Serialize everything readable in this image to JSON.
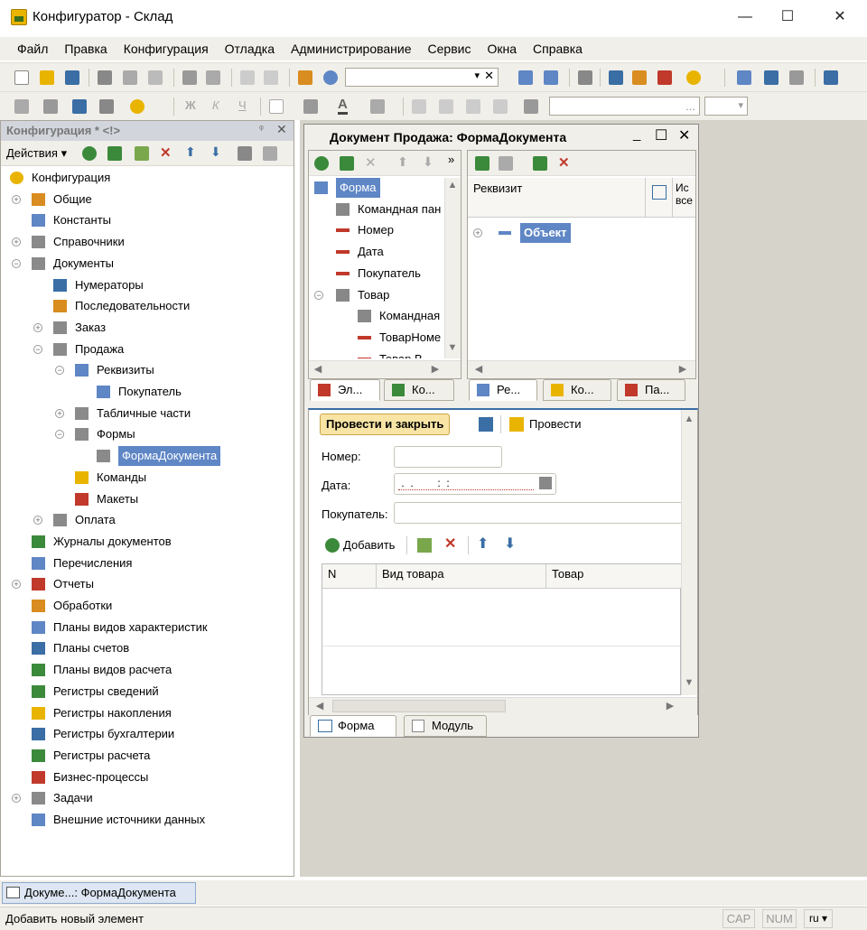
{
  "window": {
    "title": "Конфигуратор - Склад",
    "minimize": "—",
    "maximize": "☐",
    "close": "✕"
  },
  "menu": [
    "Файл",
    "Правка",
    "Конфигурация",
    "Отладка",
    "Администрирование",
    "Сервис",
    "Окна",
    "Справка"
  ],
  "left_panel": {
    "title": "Конфигурация * <!>",
    "actions_label": "Действия ▾",
    "tree": [
      {
        "label": "Конфигурация",
        "level": 0,
        "expander": "",
        "icon": "config-root-icon",
        "color": "#e9b400"
      },
      {
        "label": "Общие",
        "level": 0,
        "expander": "+",
        "icon": "common-icon",
        "color": "#d98c1f"
      },
      {
        "label": "Константы",
        "level": 0,
        "expander": "",
        "icon": "constants-icon",
        "color": "#5f86c5"
      },
      {
        "label": "Справочники",
        "level": 0,
        "expander": "+",
        "icon": "catalogs-icon",
        "color": "#8a8a8a"
      },
      {
        "label": "Документы",
        "level": 0,
        "expander": "−",
        "icon": "documents-icon",
        "color": "#8a8a8a"
      },
      {
        "label": "Нумераторы",
        "level": 1,
        "expander": "",
        "icon": "numerators-icon",
        "color": "#3a6ea5"
      },
      {
        "label": "Последовательности",
        "level": 1,
        "expander": "",
        "icon": "sequences-icon",
        "color": "#d98c1f"
      },
      {
        "label": "Заказ",
        "level": 1,
        "expander": "+",
        "icon": "document-icon",
        "color": "#8a8a8a"
      },
      {
        "label": "Продажа",
        "level": 1,
        "expander": "−",
        "icon": "document-icon",
        "color": "#8a8a8a"
      },
      {
        "label": "Реквизиты",
        "level": 2,
        "expander": "−",
        "icon": "attribute-icon",
        "color": "#5f86c5"
      },
      {
        "label": "Покупатель",
        "level": 3,
        "expander": "",
        "icon": "attribute-icon",
        "color": "#5f86c5"
      },
      {
        "label": "Табличные части",
        "level": 2,
        "expander": "+",
        "icon": "tabular-section-icon",
        "color": "#8a8a8a"
      },
      {
        "label": "Формы",
        "level": 2,
        "expander": "−",
        "icon": "forms-icon",
        "color": "#8a8a8a"
      },
      {
        "label": "ФормаДокумента",
        "level": 3,
        "expander": "",
        "icon": "form-icon",
        "color": "#8a8a8a",
        "selected": true
      },
      {
        "label": "Команды",
        "level": 2,
        "expander": "",
        "icon": "commands-icon",
        "color": "#e9b400"
      },
      {
        "label": "Макеты",
        "level": 2,
        "expander": "",
        "icon": "templates-icon",
        "color": "#c0392b"
      },
      {
        "label": "Оплата",
        "level": 1,
        "expander": "+",
        "icon": "document-icon",
        "color": "#8a8a8a"
      },
      {
        "label": "Журналы документов",
        "level": 0,
        "expander": "",
        "icon": "journals-icon",
        "color": "#3b8a3b"
      },
      {
        "label": "Перечисления",
        "level": 0,
        "expander": "",
        "icon": "enums-icon",
        "color": "#5f86c5"
      },
      {
        "label": "Отчеты",
        "level": 0,
        "expander": "+",
        "icon": "reports-icon",
        "color": "#c0392b"
      },
      {
        "label": "Обработки",
        "level": 0,
        "expander": "",
        "icon": "dataprocessors-icon",
        "color": "#d98c1f"
      },
      {
        "label": "Планы видов характеристик",
        "level": 0,
        "expander": "",
        "icon": "chart-of-characteristics-icon",
        "color": "#5f86c5"
      },
      {
        "label": "Планы счетов",
        "level": 0,
        "expander": "",
        "icon": "chart-of-accounts-icon",
        "color": "#3a6ea5"
      },
      {
        "label": "Планы видов расчета",
        "level": 0,
        "expander": "",
        "icon": "chart-of-calculation-icon",
        "color": "#3b8a3b"
      },
      {
        "label": "Регистры сведений",
        "level": 0,
        "expander": "",
        "icon": "information-registers-icon",
        "color": "#3b8a3b"
      },
      {
        "label": "Регистры накопления",
        "level": 0,
        "expander": "",
        "icon": "accumulation-registers-icon",
        "color": "#e9b400"
      },
      {
        "label": "Регистры бухгалтерии",
        "level": 0,
        "expander": "",
        "icon": "accounting-registers-icon",
        "color": "#3a6ea5"
      },
      {
        "label": "Регистры расчета",
        "level": 0,
        "expander": "",
        "icon": "calculation-registers-icon",
        "color": "#3b8a3b"
      },
      {
        "label": "Бизнес-процессы",
        "level": 0,
        "expander": "",
        "icon": "business-processes-icon",
        "color": "#c0392b"
      },
      {
        "label": "Задачи",
        "level": 0,
        "expander": "+",
        "icon": "tasks-icon",
        "color": "#8a8a8a"
      },
      {
        "label": "Внешние источники данных",
        "level": 0,
        "expander": "",
        "icon": "external-data-sources-icon",
        "color": "#5f86c5"
      }
    ]
  },
  "form_editor": {
    "title": "Документ Продажа: ФормаДокумента",
    "elements_tree": [
      {
        "label": "Форма",
        "level": 0,
        "expander": "",
        "selected": true,
        "icon": "form-icon"
      },
      {
        "label": "Командная пан",
        "level": 1,
        "expander": "",
        "icon": "command-bar-icon"
      },
      {
        "label": "Номер",
        "level": 1,
        "expander": "",
        "icon": "field-icon"
      },
      {
        "label": "Дата",
        "level": 1,
        "expander": "",
        "icon": "field-icon"
      },
      {
        "label": "Покупатель",
        "level": 1,
        "expander": "",
        "icon": "field-icon"
      },
      {
        "label": "Товар",
        "level": 0,
        "expander": "−",
        "icon": "table-icon"
      },
      {
        "label": "Командная",
        "level": 2,
        "expander": "",
        "icon": "command-bar-icon"
      },
      {
        "label": "ТоварНоме",
        "level": 2,
        "expander": "",
        "icon": "field-icon"
      },
      {
        "label": "Товар В",
        "level": 2,
        "expander": "",
        "icon": "field-icon"
      }
    ],
    "left_tabs": [
      "Эл...",
      "Ко..."
    ],
    "attr_header": {
      "col1": "Реквизит",
      "col2": "Ис все"
    },
    "attr_tree": [
      {
        "label": "Объект",
        "expander": "+",
        "selected": true
      }
    ],
    "right_tabs": [
      "Ре...",
      "Ко...",
      "Па..."
    ],
    "preview": {
      "post_close_button": "Провести и закрыть",
      "post_button": "Провести",
      "fields": [
        {
          "label": "Номер:",
          "value": ""
        },
        {
          "label": "Дата:",
          "value": " .  .        :  :  "
        },
        {
          "label": "Покупатель:",
          "value": ""
        }
      ],
      "add_button": "Добавить",
      "columns": [
        "N",
        "Вид товара",
        "Товар"
      ]
    },
    "bottom_tabs": [
      "Форма",
      "Модуль"
    ]
  },
  "taskbar": {
    "item": "Докуме...: ФормаДокумента"
  },
  "status": {
    "text": "Добавить новый элемент",
    "cap": "CAP",
    "num": "NUM",
    "lang": "ru ▾"
  }
}
